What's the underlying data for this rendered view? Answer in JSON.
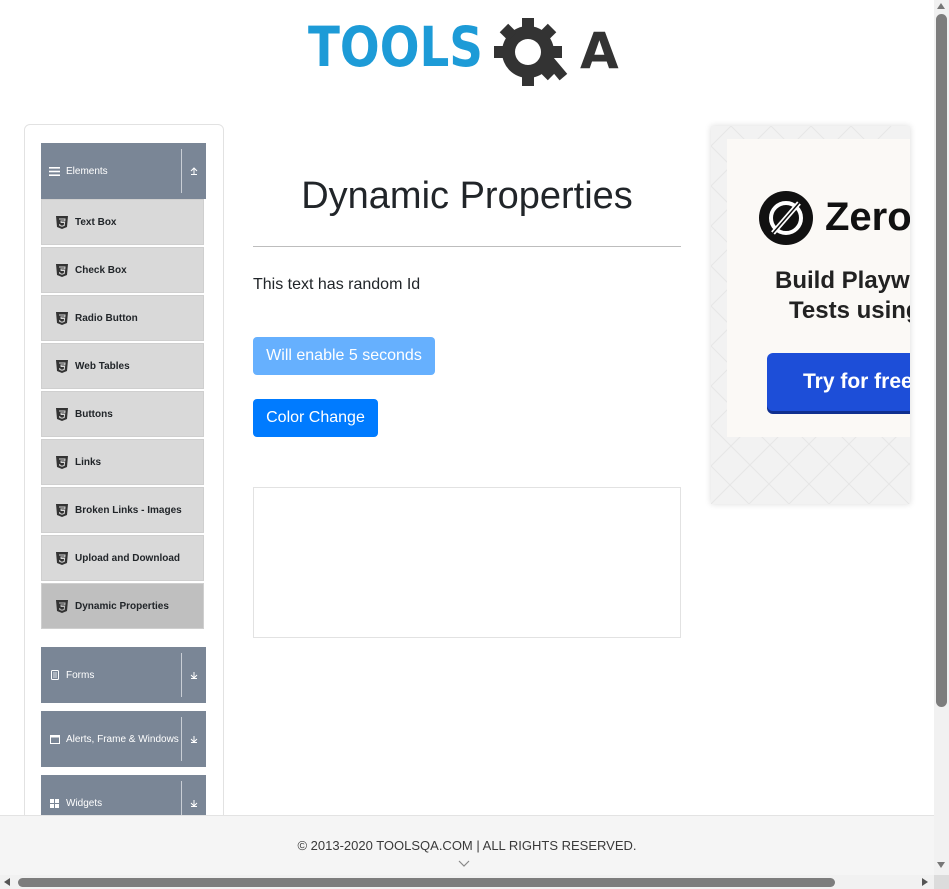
{
  "brand": {
    "logo_text_left": "TOOLS",
    "logo_text_right": "A",
    "colors": {
      "blue": "#1d9bd7",
      "dark": "#333333"
    }
  },
  "sidebar": {
    "groups": [
      {
        "label": "Elements",
        "icon": "menu-lines-icon",
        "toggle_icon": "collapse-up-icon",
        "expanded": true
      },
      {
        "label": "Forms",
        "icon": "form-icon",
        "toggle_icon": "expand-down-icon",
        "expanded": false
      },
      {
        "label": "Alerts, Frame & Windows",
        "icon": "window-icon",
        "toggle_icon": "expand-down-icon",
        "expanded": false
      },
      {
        "label": "Widgets",
        "icon": "widgets-icon",
        "toggle_icon": "expand-down-icon",
        "expanded": false
      }
    ],
    "items": [
      {
        "label": "Text Box",
        "icon": "html5-icon"
      },
      {
        "label": "Check Box",
        "icon": "html5-icon"
      },
      {
        "label": "Radio Button",
        "icon": "html5-icon"
      },
      {
        "label": "Web Tables",
        "icon": "html5-icon"
      },
      {
        "label": "Buttons",
        "icon": "html5-icon"
      },
      {
        "label": "Links",
        "icon": "html5-icon"
      },
      {
        "label": "Broken Links - Images",
        "icon": "html5-icon"
      },
      {
        "label": "Upload and Download",
        "icon": "html5-icon"
      },
      {
        "label": "Dynamic Properties",
        "icon": "html5-icon",
        "active": true
      }
    ]
  },
  "main": {
    "title": "Dynamic Properties",
    "random_text": "This text has random Id",
    "enable_button_label": "Will enable 5 seconds",
    "color_button_label": "Color Change",
    "colors": {
      "enable_button": "#66b0fe",
      "color_button": "#007bff"
    }
  },
  "ad": {
    "brand": "ZeroSt",
    "line1": "Build Playwri",
    "line2": "Tests using",
    "cta": "Try for free →",
    "colors": {
      "cta": "#1d4ed8"
    }
  },
  "footer": {
    "text": "© 2013-2020 TOOLSQA.COM | ALL RIGHTS RESERVED."
  }
}
